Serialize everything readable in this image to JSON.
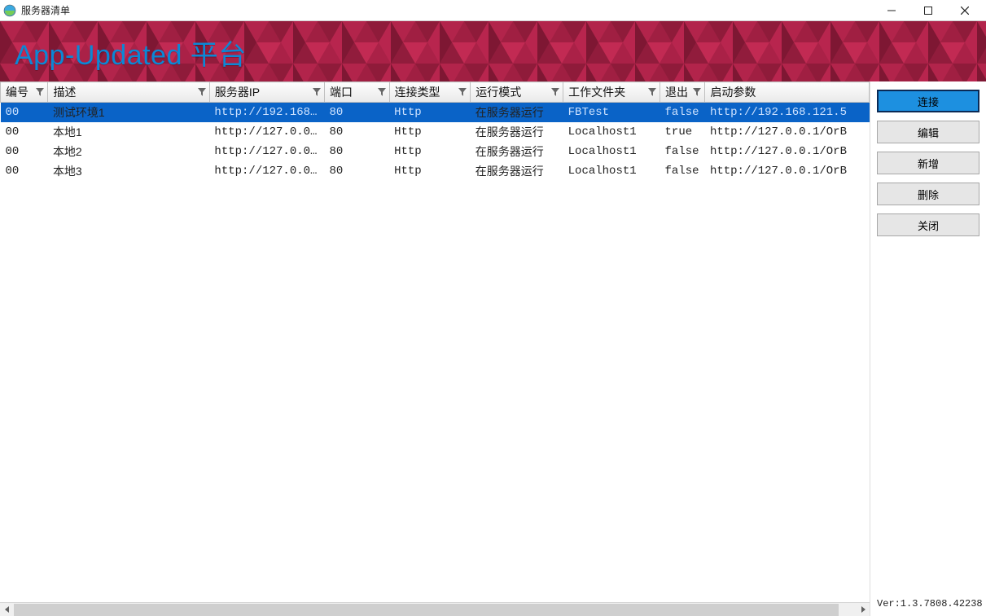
{
  "window": {
    "title": "服务器清单"
  },
  "banner": {
    "title": "App-Updated 平台"
  },
  "columns": [
    {
      "key": "id",
      "label": "编号"
    },
    {
      "key": "desc",
      "label": "描述"
    },
    {
      "key": "ip",
      "label": "服务器IP"
    },
    {
      "key": "port",
      "label": "端口"
    },
    {
      "key": "conn",
      "label": "连接类型"
    },
    {
      "key": "mode",
      "label": "运行模式"
    },
    {
      "key": "folder",
      "label": "工作文件夹"
    },
    {
      "key": "exit",
      "label": "退出"
    },
    {
      "key": "args",
      "label": "启动参数"
    }
  ],
  "rows": [
    {
      "id": "00",
      "desc": "测试环境1",
      "ip": "http://192.168…",
      "port": "80",
      "conn": "Http",
      "mode": "在服务器运行",
      "folder": "FBTest",
      "exit": "false",
      "args": "http://192.168.121.5",
      "selected": true
    },
    {
      "id": "00",
      "desc": "本地1",
      "ip": "http://127.0.0…",
      "port": "80",
      "conn": "Http",
      "mode": "在服务器运行",
      "folder": "Localhost1",
      "exit": "true",
      "args": "http://127.0.0.1/OrB",
      "selected": false
    },
    {
      "id": "00",
      "desc": "本地2",
      "ip": "http://127.0.0…",
      "port": "80",
      "conn": "Http",
      "mode": "在服务器运行",
      "folder": "Localhost1",
      "exit": "false",
      "args": "http://127.0.0.1/OrB",
      "selected": false
    },
    {
      "id": "00",
      "desc": "本地3",
      "ip": "http://127.0.0…",
      "port": "80",
      "conn": "Http",
      "mode": "在服务器运行",
      "folder": "Localhost1",
      "exit": "false",
      "args": "http://127.0.0.1/OrB",
      "selected": false
    }
  ],
  "buttons": {
    "connect": "连接",
    "edit": "编辑",
    "add": "新增",
    "delete": "删除",
    "close": "关闭"
  },
  "version": "Ver:1.3.7808.42238"
}
